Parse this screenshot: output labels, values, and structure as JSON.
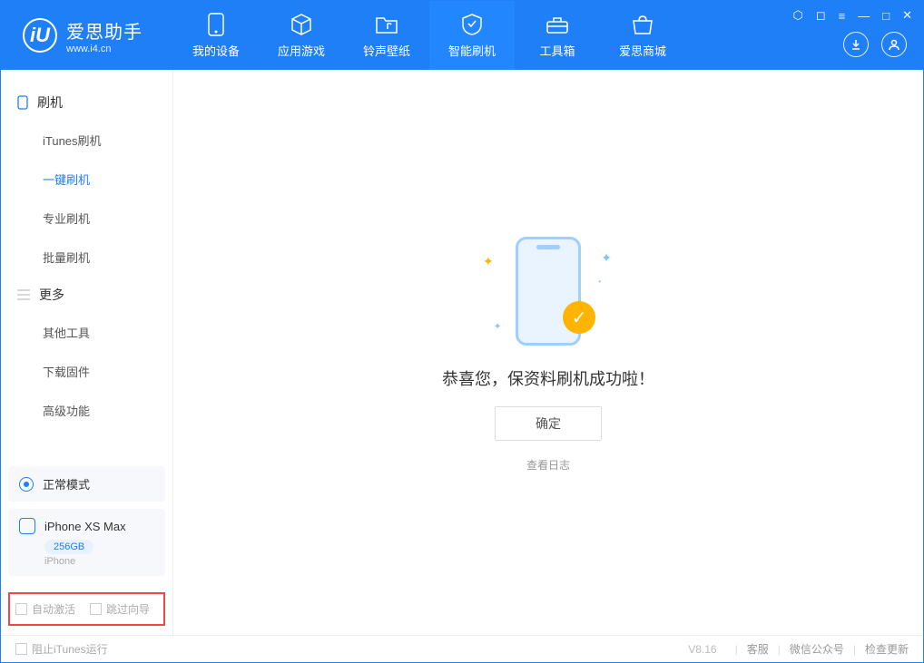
{
  "app": {
    "name": "爱思助手",
    "url": "www.i4.cn",
    "logo_letter": "iU"
  },
  "nav": {
    "items": [
      {
        "label": "我的设备"
      },
      {
        "label": "应用游戏"
      },
      {
        "label": "铃声壁纸"
      },
      {
        "label": "智能刷机"
      },
      {
        "label": "工具箱"
      },
      {
        "label": "爱思商城"
      }
    ]
  },
  "sidebar": {
    "group1": {
      "title": "刷机",
      "items": [
        "iTunes刷机",
        "一键刷机",
        "专业刷机",
        "批量刷机"
      ]
    },
    "group2": {
      "title": "更多",
      "items": [
        "其他工具",
        "下载固件",
        "高级功能"
      ]
    },
    "status": "正常模式",
    "device": {
      "name": "iPhone XS Max",
      "storage": "256GB",
      "type": "iPhone"
    },
    "checks": {
      "auto_activate": "自动激活",
      "skip_guide": "跳过向导"
    }
  },
  "main": {
    "success_text": "恭喜您，保资料刷机成功啦！",
    "confirm": "确定",
    "view_log": "查看日志"
  },
  "footer": {
    "block_itunes": "阻止iTunes运行",
    "version": "V8.16",
    "links": [
      "客服",
      "微信公众号",
      "检查更新"
    ]
  }
}
